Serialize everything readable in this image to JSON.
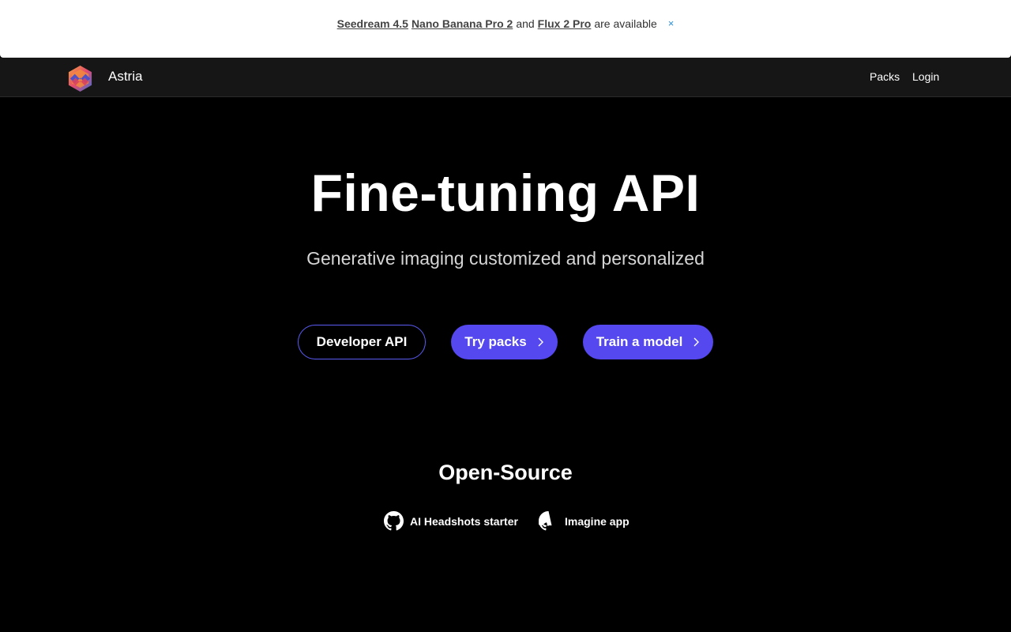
{
  "banner": {
    "link1": "Seedream 4.5",
    "link2": "Nano Banana Pro 2",
    "connector": "and",
    "link3": "Flux 2 Pro",
    "suffix": "are available",
    "close": "×"
  },
  "nav": {
    "brand": "Astria",
    "links": [
      "Packs",
      "Login"
    ]
  },
  "hero": {
    "title": "Fine-tuning API",
    "subtitle": "Generative imaging customized and personalized",
    "buttons": {
      "developer_api": "Developer API",
      "try_packs": "Try packs",
      "train_model": "Train a model"
    }
  },
  "open_source": {
    "title": "Open-Source",
    "links": [
      "AI Headshots starter",
      "Imagine app"
    ]
  },
  "colors": {
    "accent": "#5448ee",
    "banner_bg": "#ffffff",
    "nav_bg": "#161616",
    "page_bg": "#000000"
  }
}
